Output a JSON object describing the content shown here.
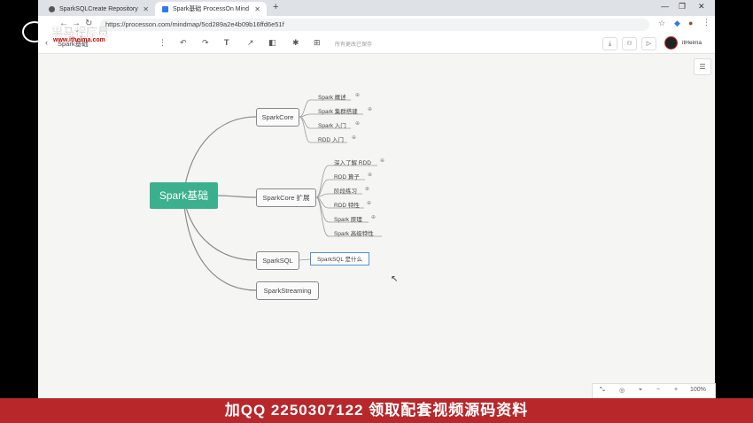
{
  "browser": {
    "tabs": [
      {
        "label": "SparkSQLCreate Repository",
        "active": false
      },
      {
        "label": "Spark基础 ProcessOn Mind",
        "active": true
      }
    ],
    "new_tab": "+",
    "url": "https://processon.com/mindmap/5cd289a2e4b09b16ffd6e51f",
    "window_controls": [
      "—",
      "❐",
      "✕"
    ]
  },
  "watermark": {
    "brand": "黑马程序员",
    "site": "www.itheima.com"
  },
  "toolbar": {
    "title": "Spark基础",
    "save_status": "所有更改已保存",
    "user": "itHeima"
  },
  "mindmap": {
    "root": "Spark基础",
    "branches": [
      {
        "label": "SparkCore",
        "children": [
          "Spark 概述",
          "Spark 集群搭建",
          "Spark 入门",
          "RDD 入门"
        ]
      },
      {
        "label": "SparkCore 扩展",
        "children": [
          "深入了解 RDD",
          "RDD 算子",
          "阶段练习",
          "RDD 特性",
          "Spark 原理",
          "Spark 高级特性"
        ]
      },
      {
        "label": "SparkSQL",
        "children": [
          "SparkSQL 是什么"
        ]
      },
      {
        "label": "SparkStreaming",
        "children": []
      }
    ]
  },
  "zoom": {
    "minus": "−",
    "plus": "+",
    "level": "100%"
  },
  "banner": "加QQ 2250307122 领取配套视频源码资料",
  "colors": {
    "root": "#3bb08f",
    "banner": "#b8282b",
    "selection": "#4a90e2"
  }
}
